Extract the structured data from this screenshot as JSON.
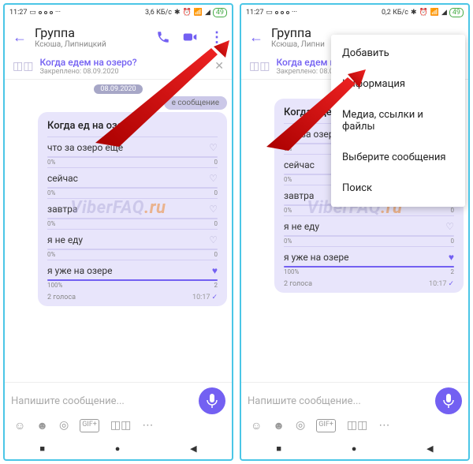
{
  "statusbar": {
    "time": "11:27",
    "net1": "3,6 КБ/с",
    "net2": "0,2 КБ/с",
    "battery": "49"
  },
  "header": {
    "title": "Группа",
    "subtitle": "Ксюша, Липницкий",
    "subtitle_cut": "Ксюша, Липни"
  },
  "pinned": {
    "title": "Когда едем на озеро?",
    "title_cut": "Когда едем н",
    "sub": "Закреплено: 08.09.2020"
  },
  "chat": {
    "date": "08.09.2020",
    "sys": "е сообщение"
  },
  "poll": {
    "question": "Когда едем на озеро?",
    "question_cut": "Когда ед   на озеро?",
    "options": [
      {
        "text": "что за озеро еще",
        "pct": "0%",
        "votes": "0",
        "fill": 0,
        "selected": false
      },
      {
        "text": "сейчас",
        "pct": "0%",
        "votes": "0",
        "fill": 0,
        "selected": false
      },
      {
        "text": "завтра",
        "pct": "0%",
        "votes": "0",
        "fill": 0,
        "selected": false
      },
      {
        "text": "я не еду",
        "pct": "0%",
        "votes": "0",
        "fill": 0,
        "selected": false
      },
      {
        "text": "я уже на озере",
        "pct": "100%",
        "votes": "2",
        "fill": 100,
        "selected": true
      }
    ],
    "total": "2 голоса",
    "time": "10:17"
  },
  "composer": {
    "placeholder": "Напишите сообщение..."
  },
  "menu": {
    "items": [
      "Добавить",
      "Информация",
      "Медиа, ссылки и файлы",
      "Выберите сообщения",
      "Поиск"
    ]
  },
  "watermark": {
    "p1": "ViberFAQ",
    "p2": ".ru"
  }
}
